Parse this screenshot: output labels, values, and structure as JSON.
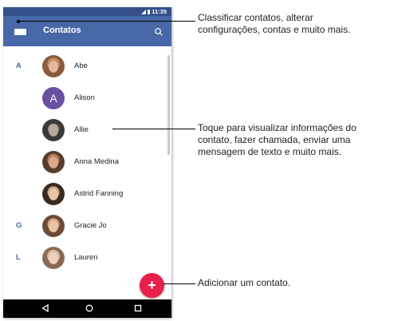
{
  "status_bar": {
    "time": "11:35"
  },
  "app_bar": {
    "title": "Contatos"
  },
  "contacts": [
    {
      "section_letter": "A",
      "name": "Abe",
      "avatar_type": "photo",
      "avatar_colors": [
        "#8a5a3c",
        "#c98d67"
      ]
    },
    {
      "section_letter": "",
      "name": "Alison",
      "avatar_type": "letter",
      "avatar_letter": "A"
    },
    {
      "section_letter": "",
      "name": "Allie",
      "avatar_type": "photo",
      "avatar_colors": [
        "#3a3a3a",
        "#9b9b9b"
      ]
    },
    {
      "section_letter": "",
      "name": "Anna Medina",
      "avatar_type": "photo",
      "avatar_colors": [
        "#5a3b2a",
        "#b07a5a"
      ]
    },
    {
      "section_letter": "",
      "name": "Astrid Fanning",
      "avatar_type": "photo",
      "avatar_colors": [
        "#3b2a20",
        "#c9a58a"
      ]
    },
    {
      "section_letter": "G",
      "name": "Gracie Jo",
      "avatar_type": "photo",
      "avatar_colors": [
        "#6b4b35",
        "#d3a783"
      ]
    },
    {
      "section_letter": "L",
      "name": "Lauren",
      "avatar_type": "photo",
      "avatar_colors": [
        "#8a6b52",
        "#d9b9a0"
      ]
    }
  ],
  "fab": {
    "label": "+"
  },
  "callouts": {
    "menu": [
      "Classificar contatos, alterar",
      "configurações, contas e muito mais."
    ],
    "contact": [
      "Toque para visualizar informações do",
      "contato, fazer chamada, enviar uma",
      "mensagem de texto e muito mais."
    ],
    "add": [
      "Adicionar um contato."
    ]
  },
  "colors": {
    "app_bar": "#4768a6",
    "status_bar": "#34508a",
    "fab": "#e8204b",
    "section_letter": "#4768a6"
  }
}
